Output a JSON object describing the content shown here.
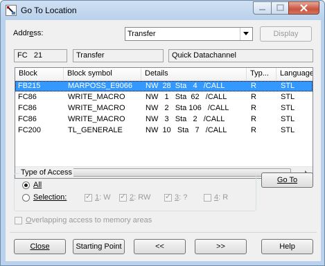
{
  "window": {
    "title": "Go To Location",
    "minimize": "–",
    "maximize": "□",
    "close": "✕"
  },
  "address": {
    "label_prefix": "Addr",
    "label_underline": "e",
    "label_suffix": "ss:",
    "value": "Transfer",
    "display_button": "Display"
  },
  "info": {
    "block": "FC   21",
    "symbol": "Transfer",
    "comment": "Quick Datachannel"
  },
  "table": {
    "columns": [
      "Block",
      "Block symbol",
      "Details",
      "Typ...",
      "Language"
    ],
    "rows": [
      {
        "block": "FB215",
        "symbol": "MARPOSS_E9066",
        "details": "NW  28  Sta   4   /CALL",
        "type": "R",
        "language": "STL",
        "selected": true
      },
      {
        "block": "FC86",
        "symbol": "WRITE_MACRO",
        "details": "NW   1   Sta  62   /CALL",
        "type": "R",
        "language": "STL",
        "selected": false
      },
      {
        "block": "FC86",
        "symbol": "WRITE_MACRO",
        "details": "NW   2   Sta 106   /CALL",
        "type": "R",
        "language": "STL",
        "selected": false
      },
      {
        "block": "FC86",
        "symbol": "WRITE_MACRO",
        "details": "NW   3   Sta   2   /CALL",
        "type": "R",
        "language": "STL",
        "selected": false
      },
      {
        "block": "FC200",
        "symbol": "TL_GENERALE",
        "details": "NW  10   Sta   7   /CALL",
        "type": "R",
        "language": "STL",
        "selected": false
      }
    ]
  },
  "access": {
    "title": "Type of Access",
    "all": "All",
    "selection": "Selection:",
    "checks": [
      {
        "num": "1",
        "label": ": W",
        "checked": true
      },
      {
        "num": "2",
        "label": ": RW",
        "checked": true
      },
      {
        "num": "3",
        "label": ": ?",
        "checked": true
      },
      {
        "num": "4",
        "label": ": R",
        "checked": false
      }
    ],
    "goto_button": "Go To"
  },
  "overlapping": {
    "label_underline": "O",
    "label_rest": "verlapping access to memory areas"
  },
  "buttons": {
    "close": "Close",
    "starting_point": "Starting Point",
    "prev": "<<",
    "next": ">>",
    "help": "Help"
  }
}
